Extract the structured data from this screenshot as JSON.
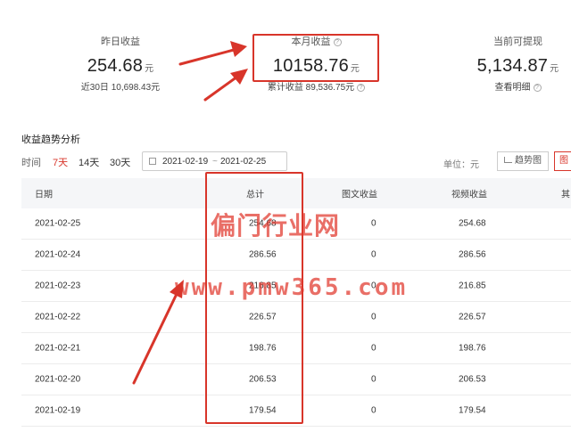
{
  "stats": {
    "yesterday": {
      "label": "昨日收益",
      "value": "254.68",
      "unit": "元",
      "sub": "近30日 10,698.43元"
    },
    "month": {
      "label": "本月收益",
      "value": "10158.76",
      "unit": "元",
      "sub": "累计收益 89,536.75元"
    },
    "withdraw": {
      "label": "当前可提现",
      "value": "5,134.87",
      "unit": "元",
      "link": "查看明细"
    }
  },
  "section": {
    "title": "收益趋势分析",
    "time_label": "时间",
    "ranges": [
      "7天",
      "14天",
      "30天"
    ],
    "selected_range": "7天",
    "date_start": "2021-02-19",
    "date_sep": "~",
    "date_end": "2021-02-25",
    "unit_label": "单位：元",
    "trend_button": "趋势图",
    "table_button": "图"
  },
  "table": {
    "headers": [
      "日期",
      "总计",
      "图文收益",
      "视频收益",
      "其"
    ],
    "rows": [
      [
        "2021-02-25",
        "254.68",
        "0",
        "254.68"
      ],
      [
        "2021-02-24",
        "286.56",
        "0",
        "286.56"
      ],
      [
        "2021-02-23",
        "216.85",
        "0",
        "216.85"
      ],
      [
        "2021-02-22",
        "226.57",
        "0",
        "226.57"
      ],
      [
        "2021-02-21",
        "198.76",
        "0",
        "198.76"
      ],
      [
        "2021-02-20",
        "206.53",
        "0",
        "206.53"
      ],
      [
        "2021-02-19",
        "179.54",
        "0",
        "179.54"
      ]
    ]
  },
  "watermark": {
    "line1": "偏门行业网",
    "line2": "www.pmw365.com"
  },
  "colors": {
    "annotation_red": "#d8352a",
    "selected_range": "#d8352a",
    "header_bg": "#f5f6f8"
  }
}
